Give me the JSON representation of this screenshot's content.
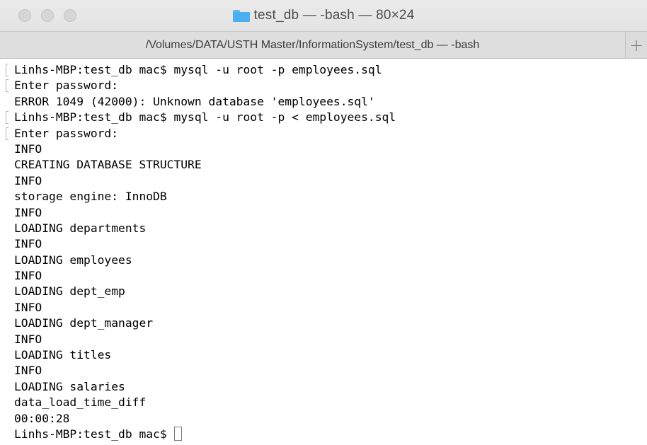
{
  "window": {
    "title": "test_db — -bash — 80×24",
    "folder_icon": "folder-icon"
  },
  "tab": {
    "label": "/Volumes/DATA/USTH Master/InformationSystem/test_db — -bash",
    "new_tab_label": "+"
  },
  "terminal": {
    "lines": [
      {
        "text": "Linhs-MBP:test_db mac$ mysql -u root -p employees.sql",
        "mark": true
      },
      {
        "text": "Enter password:",
        "mark": true
      },
      {
        "text": "ERROR 1049 (42000): Unknown database 'employees.sql'",
        "mark": false
      },
      {
        "text": "Linhs-MBP:test_db mac$ mysql -u root -p < employees.sql",
        "mark": true
      },
      {
        "text": "Enter password:",
        "mark": true
      },
      {
        "text": "INFO",
        "mark": false
      },
      {
        "text": "CREATING DATABASE STRUCTURE",
        "mark": false
      },
      {
        "text": "INFO",
        "mark": false
      },
      {
        "text": "storage engine: InnoDB",
        "mark": false
      },
      {
        "text": "INFO",
        "mark": false
      },
      {
        "text": "LOADING departments",
        "mark": false
      },
      {
        "text": "INFO",
        "mark": false
      },
      {
        "text": "LOADING employees",
        "mark": false
      },
      {
        "text": "INFO",
        "mark": false
      },
      {
        "text": "LOADING dept_emp",
        "mark": false
      },
      {
        "text": "INFO",
        "mark": false
      },
      {
        "text": "LOADING dept_manager",
        "mark": false
      },
      {
        "text": "INFO",
        "mark": false
      },
      {
        "text": "LOADING titles",
        "mark": false
      },
      {
        "text": "INFO",
        "mark": false
      },
      {
        "text": "LOADING salaries",
        "mark": false
      },
      {
        "text": "data_load_time_diff",
        "mark": false
      },
      {
        "text": "00:00:28",
        "mark": false
      }
    ],
    "prompt": "Linhs-MBP:test_db mac$ "
  }
}
